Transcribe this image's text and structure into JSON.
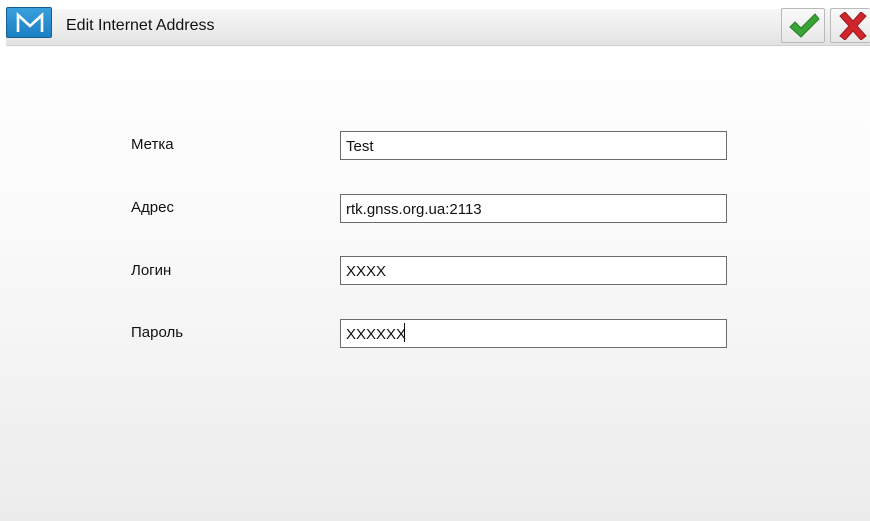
{
  "window": {
    "title": "Edit Internet Address",
    "app_icon": "m-logo-icon",
    "ok_icon": "green-checkmark-icon",
    "cancel_icon": "red-x-icon"
  },
  "form": {
    "fields": [
      {
        "label": "Метка",
        "value": "Test"
      },
      {
        "label": "Адрес",
        "value": "rtk.gnss.org.ua:2113"
      },
      {
        "label": "Логин",
        "value": "XXXX"
      },
      {
        "label": "Пароль",
        "value": "XXXXXX"
      }
    ]
  },
  "colors": {
    "accent": "#1b7fc4",
    "ok": "#3aa335",
    "cancel": "#d0262b"
  }
}
